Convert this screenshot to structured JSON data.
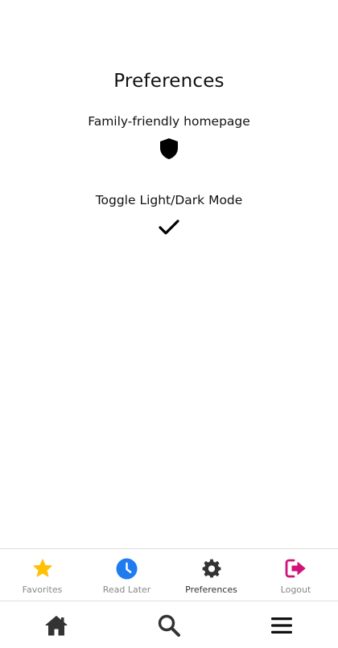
{
  "page": {
    "title": "Preferences"
  },
  "preferences": [
    {
      "label": "Family-friendly homepage",
      "icon": "shield-icon"
    },
    {
      "label": "Toggle Light/Dark Mode",
      "icon": "checkmark-icon"
    }
  ],
  "tabs": [
    {
      "label": "Favorites",
      "icon": "star-icon",
      "color": "#FFC107"
    },
    {
      "label": "Read Later",
      "icon": "clock-icon",
      "color": "#1E7BF0"
    },
    {
      "label": "Preferences",
      "icon": "gear-icon",
      "color": "#333333",
      "active": true
    },
    {
      "label": "Logout",
      "icon": "logout-icon",
      "color": "#D1127A"
    }
  ],
  "bottom_nav": [
    {
      "icon": "home-icon"
    },
    {
      "icon": "search-icon"
    },
    {
      "icon": "menu-icon"
    }
  ]
}
